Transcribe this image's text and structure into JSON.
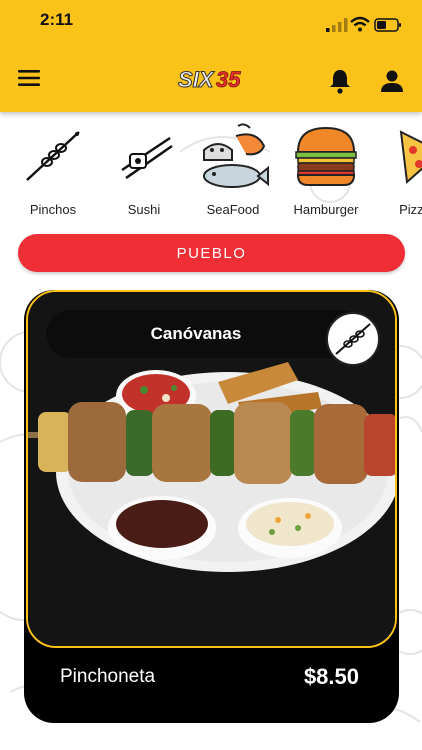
{
  "status_bar": {
    "time": "2:11"
  },
  "app_bar": {
    "logo_text": "SIX35",
    "menu_icon": "hamburger-menu-icon",
    "notification_icon": "bell-icon",
    "profile_icon": "user-icon"
  },
  "categories": [
    {
      "label": "Pinchos",
      "icon": "skewer-icon"
    },
    {
      "label": "Sushi",
      "icon": "sushi-icon"
    },
    {
      "label": "SeaFood",
      "icon": "seafood-icon"
    },
    {
      "label": "Hamburger",
      "icon": "hamburger-icon"
    },
    {
      "label": "Pizza",
      "icon": "pizza-icon"
    }
  ],
  "location_button": {
    "label": "PUEBLO"
  },
  "product_card": {
    "store": "Canóvanas",
    "name": "Pinchoneta",
    "price": "$8.50",
    "category_badge_icon": "skewer-icon"
  },
  "colors": {
    "brand_yellow": "#fbc21a",
    "button_red": "#ef2e35",
    "card_black": "#000000"
  }
}
